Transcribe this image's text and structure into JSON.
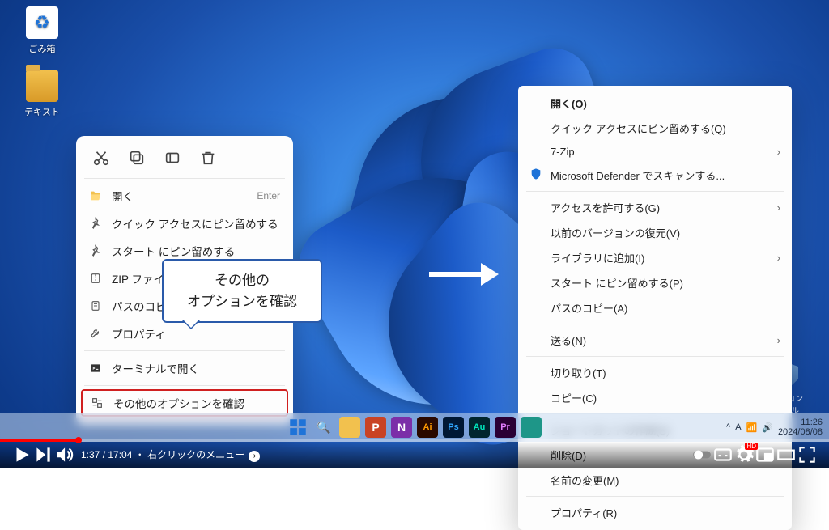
{
  "desktop": {
    "recycle_label": "ごみ箱",
    "folder_label": "テキスト",
    "shield_label": "コアコンシェル"
  },
  "menu_left": {
    "open": "開く",
    "open_shortcut": "Enter",
    "pin_quick": "クイック アクセスにピン留めする",
    "pin_start": "スタート にピン留めする",
    "zip": "ZIP ファイルに圧",
    "copy_path": "パスのコピー",
    "properties": "プロパティ",
    "terminal": "ターミナルで開く",
    "more_options": "その他のオプションを確認"
  },
  "callout": {
    "line1": "その他の",
    "line2": "オプションを確認"
  },
  "menu_right": {
    "open": "開く(O)",
    "pin_quick": "クイック アクセスにピン留めする(Q)",
    "seven_zip": "7-Zip",
    "defender": "Microsoft Defender でスキャンする...",
    "grant_access": "アクセスを許可する(G)",
    "restore": "以前のバージョンの復元(V)",
    "library": "ライブラリに追加(I)",
    "pin_start": "スタート にピン留めする(P)",
    "copy_path": "パスのコピー(A)",
    "send_to": "送る(N)",
    "cut": "切り取り(T)",
    "copy": "コピー(C)",
    "shortcut": "ショートカットの作成(S)",
    "delete": "削除(D)",
    "rename": "名前の変更(M)",
    "properties": "プロパティ(R)"
  },
  "player": {
    "current_time": "1:37",
    "total_time": "17:04",
    "chapter": "右クリックのメニュー",
    "clock": "11:26",
    "date": "2024/08/08",
    "quality": "HD"
  }
}
